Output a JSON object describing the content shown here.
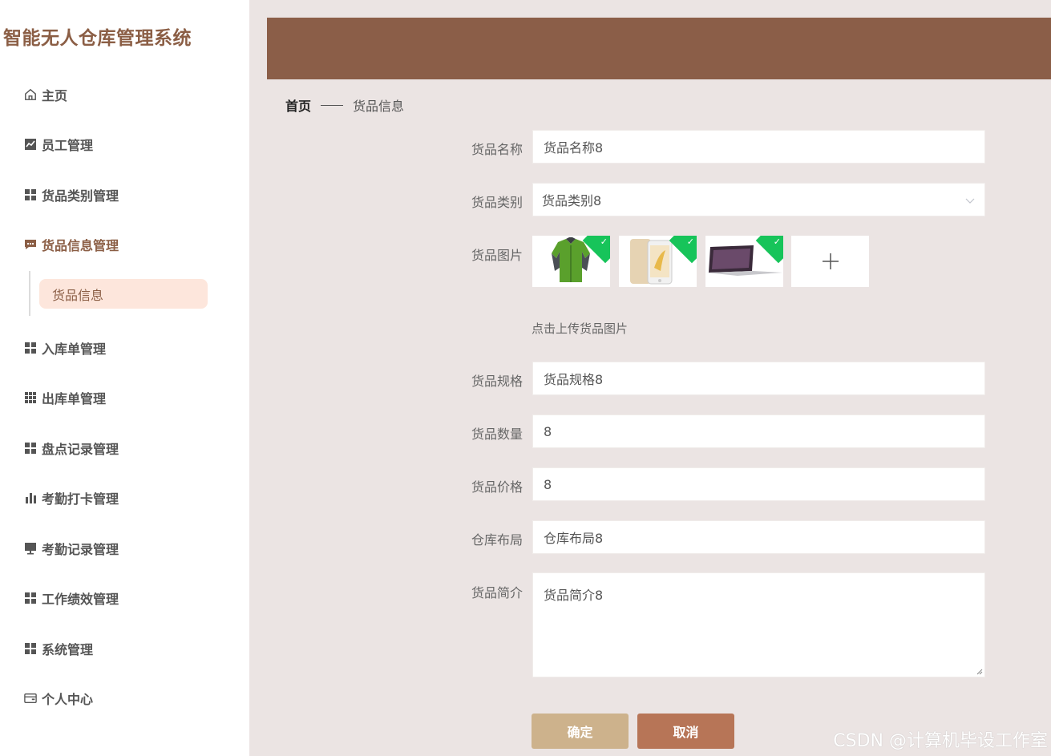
{
  "app": {
    "title": "智能无人仓库管理系统"
  },
  "sidebar": {
    "items": [
      {
        "label": "主页",
        "icon": "home-icon"
      },
      {
        "label": "员工管理",
        "icon": "chart-icon"
      },
      {
        "label": "货品类别管理",
        "icon": "grid-icon"
      },
      {
        "label": "货品信息管理",
        "icon": "chat-icon"
      },
      {
        "label": "入库单管理",
        "icon": "grid-icon"
      },
      {
        "label": "出库单管理",
        "icon": "grid9-icon"
      },
      {
        "label": "盘点记录管理",
        "icon": "grid-icon"
      },
      {
        "label": "考勤打卡管理",
        "icon": "bar-chart-icon"
      },
      {
        "label": "考勤记录管理",
        "icon": "monitor-icon"
      },
      {
        "label": "工作绩效管理",
        "icon": "grid-icon"
      },
      {
        "label": "系统管理",
        "icon": "grid-icon"
      },
      {
        "label": "个人中心",
        "icon": "wallet-icon"
      }
    ],
    "submenu": {
      "label": "货品信息"
    }
  },
  "breadcrumb": {
    "home": "首页",
    "current": "货品信息"
  },
  "form": {
    "name": {
      "label": "货品名称",
      "value": "货品名称8"
    },
    "category": {
      "label": "货品类别",
      "value": "货品类别8"
    },
    "image": {
      "label": "货品图片",
      "hint": "点击上传货品图片"
    },
    "spec": {
      "label": "货品规格",
      "value": "货品规格8"
    },
    "quantity": {
      "label": "货品数量",
      "value": "8"
    },
    "price": {
      "label": "货品价格",
      "value": "8"
    },
    "layout": {
      "label": "仓库布局",
      "value": "仓库布局8"
    },
    "intro": {
      "label": "货品简介",
      "value": "货品简介8"
    }
  },
  "buttons": {
    "confirm": "确定",
    "cancel": "取消"
  },
  "watermark": "CSDN @计算机毕设工作室",
  "colors": {
    "brand": "#8b5e48",
    "active_bg": "#fde6dc",
    "confirm": "#cdb28c",
    "cancel": "#b77557",
    "check": "#17c45a"
  }
}
